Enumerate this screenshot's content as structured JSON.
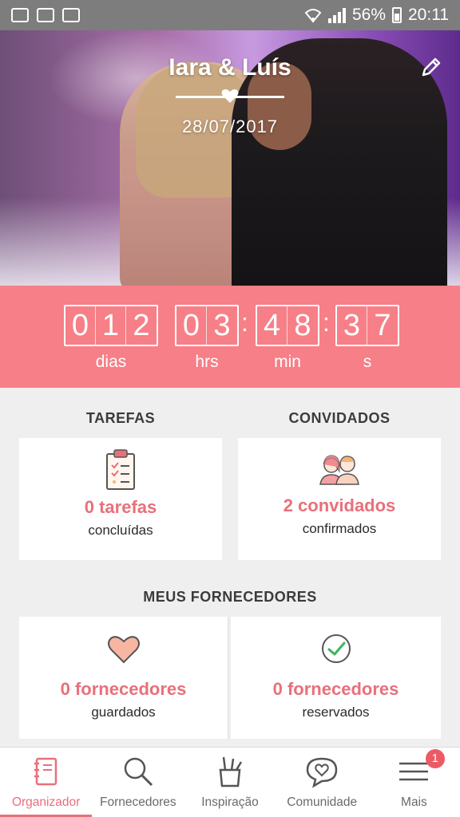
{
  "status_bar": {
    "battery": "56%",
    "time": "20:11"
  },
  "hero": {
    "names": "Iara & Luís",
    "date": "28/07/2017",
    "icons": [
      "heart-icon",
      "edit-icon"
    ]
  },
  "countdown": {
    "days": [
      "0",
      "1",
      "2"
    ],
    "hours": [
      "0",
      "3"
    ],
    "minutes": [
      "4",
      "8"
    ],
    "seconds": [
      "3",
      "7"
    ],
    "labels": {
      "days": "dias",
      "hours": "hrs",
      "minutes": "min",
      "seconds": "s"
    },
    "background_color": "#f77f87"
  },
  "tasks": {
    "title": "TAREFAS",
    "count_text": "0 tarefas",
    "status_text": "concluídas"
  },
  "guests": {
    "title": "CONVIDADOS",
    "count_text": "2 convidados",
    "status_text": "confirmados"
  },
  "vendors": {
    "title": "MEUS FORNECEDORES",
    "saved_count": "0 fornecedores",
    "saved_label": "guardados",
    "booked_count": "0 fornecedores",
    "booked_label": "reservados"
  },
  "bottom_nav": {
    "items": [
      {
        "label": "Organizador",
        "icon": "notebook-icon",
        "active": true
      },
      {
        "label": "Fornecedores",
        "icon": "search-icon",
        "active": false
      },
      {
        "label": "Inspiração",
        "icon": "pencil-cup-icon",
        "active": false
      },
      {
        "label": "Comunidade",
        "icon": "chat-heart-icon",
        "active": false
      },
      {
        "label": "Mais",
        "icon": "menu-icon",
        "active": false,
        "badge": "1"
      }
    ]
  },
  "accent_color": "#e8707a"
}
